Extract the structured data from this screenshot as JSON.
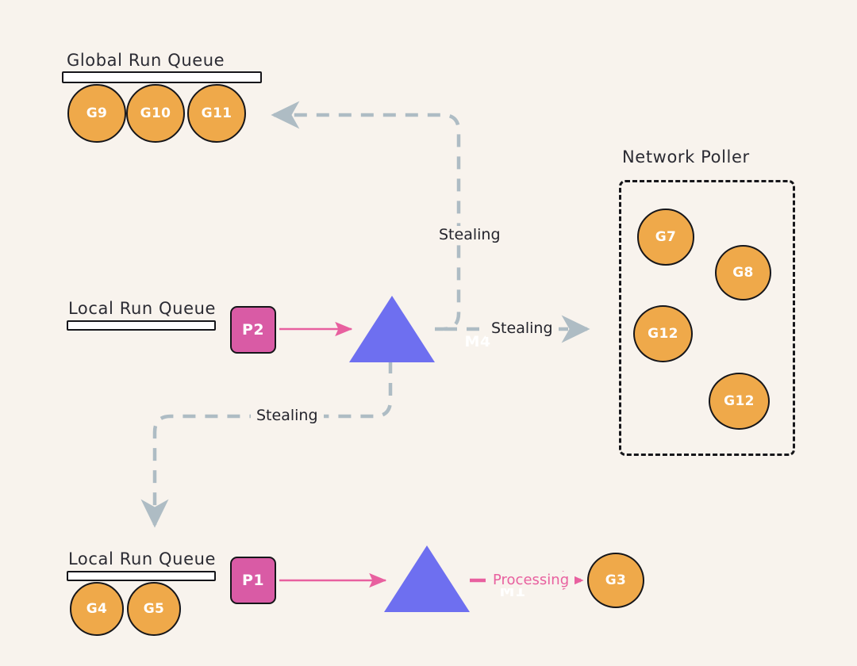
{
  "palette": {
    "background": "#f8f3ed",
    "goroutine_orange": "#efa94a",
    "processor_pink": "#d95ba5",
    "machine_blue": "#6e6ff0",
    "stroke_black": "#16161a",
    "dashed_steal": "#aebcc4",
    "processing_pink": "#e8609f",
    "queue_bar_fill": "#ffffff"
  },
  "sections": {
    "global_run_queue": {
      "caption": "Global Run Queue",
      "goroutines": [
        {
          "label": "G9"
        },
        {
          "label": "G10"
        },
        {
          "label": "G11"
        }
      ]
    },
    "network_poller": {
      "caption": "Network Poller",
      "goroutines": [
        {
          "label": "G7"
        },
        {
          "label": "G8"
        },
        {
          "label": "G12"
        },
        {
          "label": "G12"
        }
      ]
    },
    "local_run_queue_top": {
      "caption": "Local Run Queue",
      "goroutines": [],
      "processor": {
        "label": "P2"
      },
      "machine": {
        "label": "M4"
      }
    },
    "local_run_queue_bottom": {
      "caption": "Local Run Queue",
      "goroutines": [
        {
          "label": "G4"
        },
        {
          "label": "G5"
        }
      ],
      "processor": {
        "label": "P1"
      },
      "machine": {
        "label": "M1"
      },
      "running_goroutine": {
        "label": "G3"
      }
    }
  },
  "edges": {
    "steal_to_global": {
      "label": "Stealing"
    },
    "steal_to_poller": {
      "label": "Stealing"
    },
    "steal_to_local": {
      "label": "Stealing"
    },
    "processing": {
      "label": "Processing"
    }
  }
}
